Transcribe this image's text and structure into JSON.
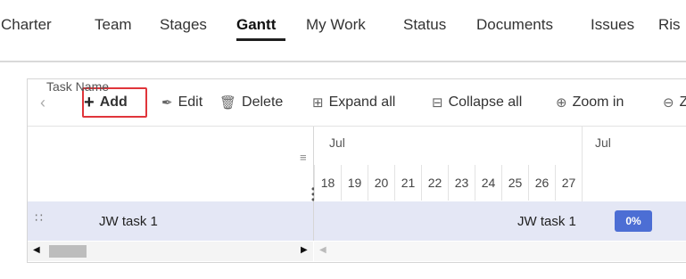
{
  "nav": {
    "tabs": [
      {
        "label": "Charter"
      },
      {
        "label": "Team"
      },
      {
        "label": "Stages"
      },
      {
        "label": "Gantt"
      },
      {
        "label": "My Work"
      },
      {
        "label": "Status"
      },
      {
        "label": "Documents"
      },
      {
        "label": "Issues"
      },
      {
        "label": "Ris"
      }
    ],
    "active": "Gantt"
  },
  "toolbar": {
    "back_icon": "chevron-left-icon",
    "add_label": "Add",
    "edit_label": "Edit",
    "delete_label": "Delete",
    "expand_label": "Expand all",
    "collapse_label": "Collapse all",
    "zoom_in_label": "Zoom in",
    "zoom_out_label": "Z",
    "highlight_color": "#e0353b"
  },
  "grid": {
    "column_header": "Task Name",
    "rows": [
      {
        "task_name": "JW task 1"
      }
    ]
  },
  "timeline": {
    "months": [
      "Jul",
      "Jul"
    ],
    "days": [
      "18",
      "19",
      "20",
      "21",
      "22",
      "23",
      "24",
      "25",
      "26",
      "27"
    ],
    "bar_label": "JW task 1",
    "progress": "0%",
    "progress_color": "#4c6ed4"
  }
}
